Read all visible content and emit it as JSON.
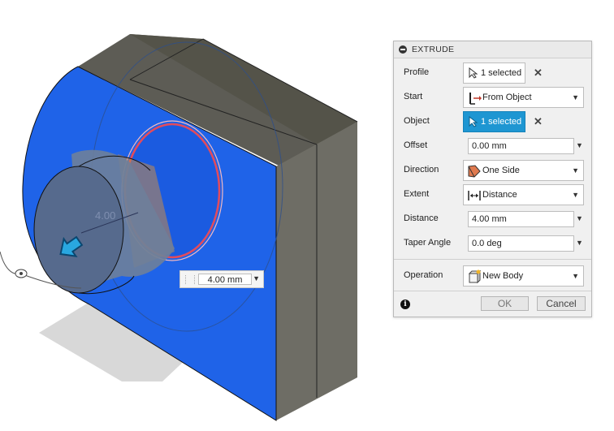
{
  "viewport": {
    "dimension_label": "4.00",
    "float_input": {
      "value": "4.00 mm"
    }
  },
  "dialog": {
    "title": "EXTRUDE",
    "profile": {
      "label": "Profile",
      "value": "1 selected"
    },
    "start": {
      "label": "Start",
      "value": "From Object"
    },
    "object": {
      "label": "Object",
      "value": "1 selected"
    },
    "offset": {
      "label": "Offset",
      "value": "0.00 mm"
    },
    "direction": {
      "label": "Direction",
      "value": "One Side"
    },
    "extent": {
      "label": "Extent",
      "value": "Distance"
    },
    "distance": {
      "label": "Distance",
      "value": "4.00 mm"
    },
    "taper": {
      "label": "Taper Angle",
      "value": "0.0 deg"
    },
    "operation": {
      "label": "Operation",
      "value": "New Body"
    },
    "ok_label": "OK",
    "cancel_label": "Cancel",
    "clear_glyph": "✕",
    "info_glyph": "i"
  },
  "colors": {
    "face_blue": "#1f63e8",
    "body_gray": "#6b6a60",
    "highlight": "#1e96d2"
  }
}
